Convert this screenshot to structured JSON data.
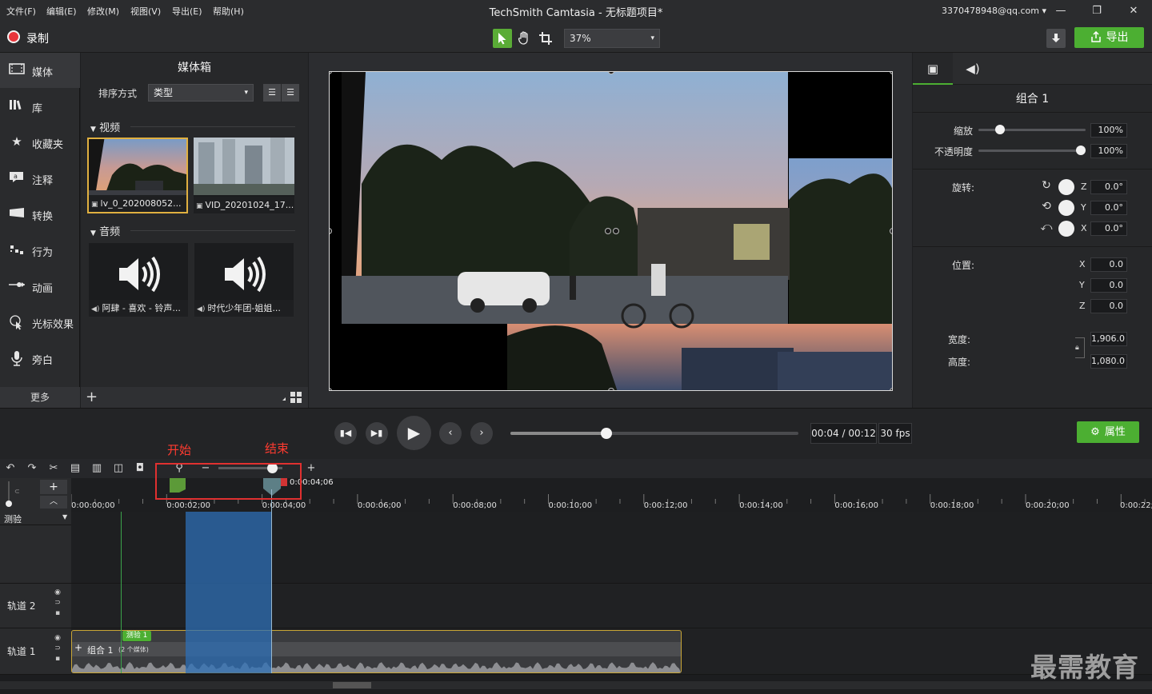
{
  "menu": [
    "文件(F)",
    "编辑(E)",
    "修改(M)",
    "视图(V)",
    "导出(E)",
    "帮助(H)"
  ],
  "window": {
    "title": "TechSmith Camtasia - 无标题项目*",
    "account": "3370478948@qq.com",
    "account_caret": "▾",
    "minimize": "—",
    "restore": "❐",
    "close": "✕"
  },
  "toolbar": {
    "record": "录制",
    "zoom": "37%",
    "export": "导出",
    "caret": "▾"
  },
  "sidenav": {
    "items": [
      {
        "label": "媒体",
        "icon": "media-icon"
      },
      {
        "label": "库",
        "icon": "library-icon"
      },
      {
        "label": "收藏夹",
        "icon": "star-icon"
      },
      {
        "label": "注释",
        "icon": "annotation-icon"
      },
      {
        "label": "转换",
        "icon": "transition-icon"
      },
      {
        "label": "行为",
        "icon": "behavior-icon"
      },
      {
        "label": "动画",
        "icon": "animation-icon"
      },
      {
        "label": "光标效果",
        "icon": "cursor-icon"
      },
      {
        "label": "旁白",
        "icon": "microphone-icon"
      }
    ],
    "more": "更多"
  },
  "mediabin": {
    "title": "媒体箱",
    "sort_label": "排序方式",
    "sort_value": "类型",
    "video_section": "视频",
    "audio_section": "音频",
    "videos": [
      {
        "name": "lv_0_202008052..."
      },
      {
        "name": "VID_20201024_17..."
      }
    ],
    "audios": [
      {
        "name": "阿肆 - 喜欢 - 铃声..."
      },
      {
        "name": "时代少年团-姐姐..."
      }
    ]
  },
  "properties": {
    "title": "组合 1",
    "scale_label": "缩放",
    "scale_value": "100%",
    "scale_level": 0.2,
    "opacity_label": "不透明度",
    "opacity_value": "100%",
    "opacity_level": 1.0,
    "rotation_label": "旋转:",
    "rotation": [
      {
        "axis": "Z",
        "value": "0.0°"
      },
      {
        "axis": "Y",
        "value": "0.0°"
      },
      {
        "axis": "X",
        "value": "0.0°"
      }
    ],
    "position_label": "位置:",
    "position": [
      {
        "axis": "X",
        "value": "0.0"
      },
      {
        "axis": "Y",
        "value": "0.0"
      },
      {
        "axis": "Z",
        "value": "0.0"
      }
    ],
    "width_label": "宽度:",
    "width_value": "1,906.0",
    "height_label": "高度:",
    "height_value": "1,080.0"
  },
  "playback": {
    "time": "00:04 / 00:12",
    "fps": "30 fps",
    "props_button": "属性",
    "progress": 0.333
  },
  "timeline": {
    "callout_start": "开始",
    "callout_end": "结束",
    "end_marker_time": "0:00:04;06",
    "ticks": [
      "0:00:00;00",
      "0:00:02;00",
      "0:00:04;00",
      "0:00:06;00",
      "0:00:08;00",
      "0:00:10;00",
      "0:00:12;00",
      "0:00:14;00",
      "0:00:16;00",
      "0:00:18;00",
      "0:00:20;00",
      "0:00:22;00"
    ],
    "marker_track": "测验",
    "tracks": [
      {
        "name": "轨道 2"
      },
      {
        "name": "轨道 1"
      }
    ],
    "clip_label": "组合 1",
    "clip_sub": "(2 个媒体)",
    "quiz_tag": "测验 1",
    "zoom_level": 0.85
  },
  "watermark": "最需教育",
  "colors": {
    "accent": "#4caf32",
    "record": "#e8353b",
    "selection": "#2d6fb5",
    "callout": "#e03030"
  }
}
